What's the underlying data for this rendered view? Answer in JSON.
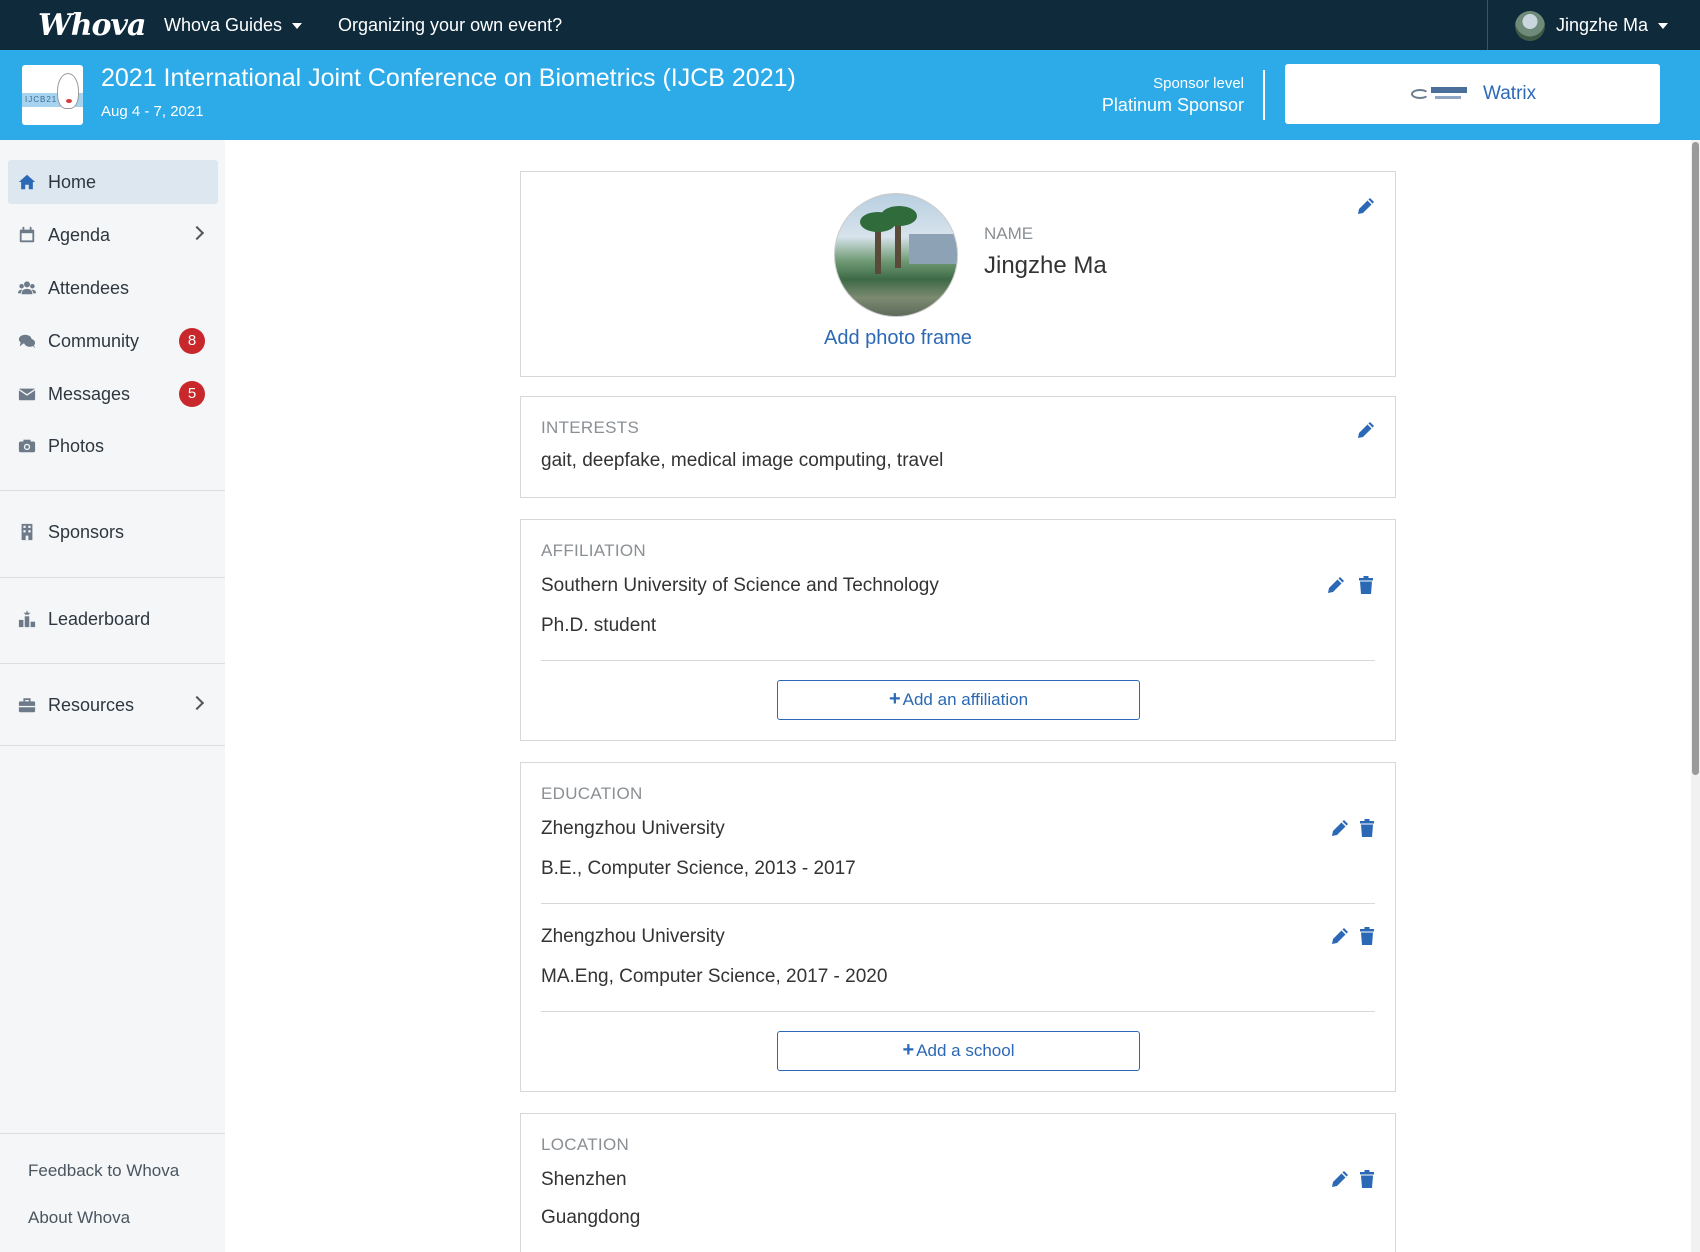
{
  "topnav": {
    "logo": "Whova",
    "guides": "Whova Guides",
    "organize": "Organizing your own event?",
    "user_name": "Jingzhe Ma"
  },
  "event": {
    "logo_text": "IJCB21",
    "title": "2021 International Joint Conference on Biometrics (IJCB 2021)",
    "dates": "Aug 4 - 7, 2021",
    "sponsor_label": "Sponsor level",
    "sponsor_level": "Platinum Sponsor",
    "sponsor_name": "Watrix"
  },
  "sidebar": {
    "items": [
      {
        "label": "Home",
        "icon": "home-icon",
        "active": true
      },
      {
        "label": "Agenda",
        "icon": "calendar-icon",
        "chevron": true
      },
      {
        "label": "Attendees",
        "icon": "users-icon"
      },
      {
        "label": "Community",
        "icon": "comments-icon",
        "badge": "8"
      },
      {
        "label": "Messages",
        "icon": "envelope-icon",
        "badge": "5"
      },
      {
        "label": "Photos",
        "icon": "camera-icon"
      },
      {
        "label": "Sponsors",
        "icon": "building-icon"
      },
      {
        "label": "Leaderboard",
        "icon": "leaderboard-icon"
      },
      {
        "label": "Resources",
        "icon": "briefcase-icon",
        "chevron": true
      }
    ],
    "footer": {
      "feedback": "Feedback to Whova",
      "about": "About Whova"
    }
  },
  "profile": {
    "add_photo_frame": "Add photo frame",
    "name_label": "NAME",
    "name": "Jingzhe Ma"
  },
  "interests": {
    "label": "INTERESTS",
    "value": "gait, deepfake, medical image computing, travel"
  },
  "affiliation": {
    "label": "AFFILIATION",
    "org": "Southern University of Science and Technology",
    "title": "Ph.D. student",
    "add_label": "Add an affiliation"
  },
  "education": {
    "label": "EDUCATION",
    "entries": [
      {
        "school": "Zhengzhou University",
        "detail": "B.E., Computer Science, 2013 - 2017"
      },
      {
        "school": "Zhengzhou University",
        "detail": "MA.Eng, Computer Science, 2017 - 2020"
      }
    ],
    "add_label": "Add a school"
  },
  "location": {
    "label": "LOCATION",
    "city": "Shenzhen",
    "region": "Guangdong"
  },
  "colors": {
    "nav_bg": "#0e2a3b",
    "event_bar": "#2daae8",
    "accent": "#2b68b5",
    "badge": "#c8272b"
  }
}
